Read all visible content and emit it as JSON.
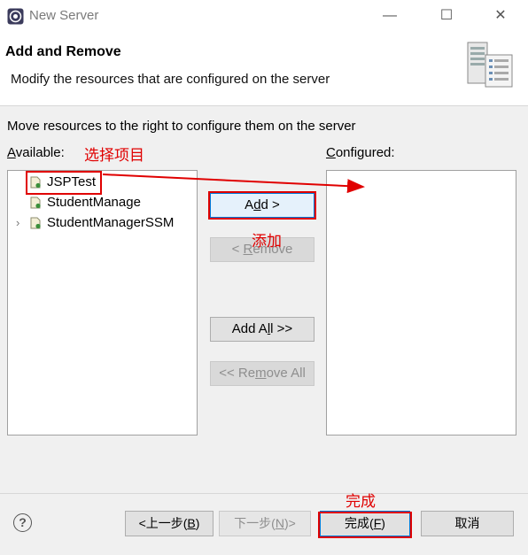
{
  "window": {
    "title": "New Server",
    "minimize": "—",
    "maximize": "☐",
    "close": "✕"
  },
  "header": {
    "title": "Add and Remove",
    "description": "Modify the resources that are configured on the server"
  },
  "instructions": "Move resources to the right to configure them on the server",
  "available": {
    "label_prefix": "",
    "label_mnemonic": "A",
    "label_rest": "vailable:",
    "items": [
      {
        "label": "JSPTest",
        "expandable": false
      },
      {
        "label": "StudentManage",
        "expandable": false
      },
      {
        "label": "StudentManagerSSM",
        "expandable": true
      }
    ]
  },
  "configured": {
    "label_mnemonic": "C",
    "label_rest": "onfigured:"
  },
  "buttons": {
    "add_pre": "A",
    "add_mn": "d",
    "add_post": "d >",
    "remove_pre": "< ",
    "remove_mn": "R",
    "remove_post": "emove",
    "add_all_pre": "Add A",
    "add_all_mn": "l",
    "add_all_post": "l >>",
    "remove_all_pre": "<< Re",
    "remove_all_mn": "m",
    "remove_all_post": "ove All"
  },
  "footer": {
    "help": "?",
    "back_pre": "<上一步(",
    "back_mn": "B",
    "back_post": ")",
    "next_pre": "下一步(",
    "next_mn": "N",
    "next_post": ")>",
    "finish_pre": "完成(",
    "finish_mn": "F",
    "finish_post": ")",
    "cancel": "取消"
  },
  "annotations": {
    "select": "选择项目",
    "add": "添加",
    "finish": "完成",
    "color": "#e00000"
  }
}
